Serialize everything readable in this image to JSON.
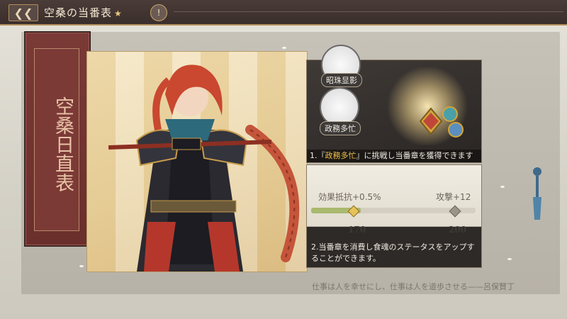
{
  "header": {
    "back_icon": "back-arrow-icon",
    "title": "空桑の当番表",
    "info_label": "!"
  },
  "scroll": {
    "vertical_title": "空桑日直表"
  },
  "panel_top": {
    "avatar_top_label": "昭珠显影",
    "avatar_main_label": "政務多忙",
    "caption_prefix": "1.『",
    "caption_highlight": "政務多忙",
    "caption_suffix": "』に挑戦し当番章を獲得できます"
  },
  "panel_bottom": {
    "stat_a_label": "効果抵抗+0.5%",
    "stat_b_label": "攻撃+12",
    "stat_a_value": "170",
    "stat_b_value": "200",
    "progress": 0.3,
    "caption": "2.当番章を消費し食魂のステータスをアップすることができます。"
  },
  "footer": {
    "quote": "仕事は人を幸せにし、仕事は人を道歩させる——呂保賢丁"
  },
  "colors": {
    "accent_gold": "#f0c04a",
    "scroll_red": "#7a3a36",
    "stat_green": "#a9b96e"
  }
}
